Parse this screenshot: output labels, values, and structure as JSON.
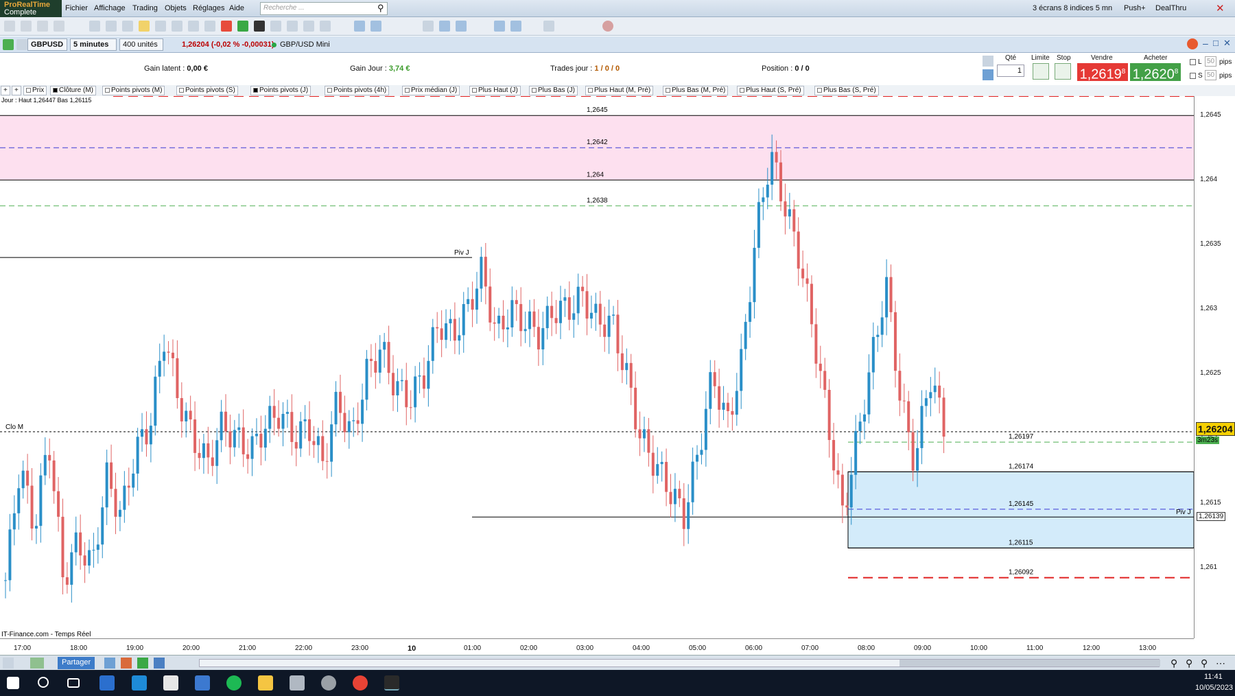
{
  "app": {
    "logo_line1": "ProRealTime",
    "logo_line2": "Complete"
  },
  "menu": [
    "Fichier",
    "Affichage",
    "Trading",
    "Objets",
    "Réglages",
    "Aide"
  ],
  "search": {
    "placeholder": "Recherche ..."
  },
  "topright": {
    "screens": "3 écrans 8 indices 5 mn",
    "push": "Push+",
    "dealthru": "DealThru"
  },
  "controls": {
    "instrument": "GBPUSD",
    "timeframe": "5 minutes",
    "units": "400 unités",
    "price_change": "1,26204 (-0,02 % -0,00031)",
    "market_name": "GBP/USD Mini"
  },
  "info": {
    "latent_label": "Gain latent :",
    "latent_value": "0,00 €",
    "day_gain_label": "Gain Jour :",
    "day_gain_value": "3,74 €",
    "trades_label": "Trades jour :",
    "trades_value": "1 / 0 / 0",
    "position_label": "Position :",
    "position_value": "0",
    "position_value2": "/ 0"
  },
  "order": {
    "qty_label": "Qté",
    "qty_value": "1",
    "limit_label": "Limite",
    "stop_label": "Stop",
    "sell_label": "Vendre",
    "sell_price": "1,2619",
    "sell_sup": "8",
    "buy_label": "Acheter",
    "buy_price": "1,2620",
    "buy_sup": "8",
    "l_label": "L",
    "s_label": "S",
    "pips_value": "50",
    "pips_label": "pips"
  },
  "tabs": [
    "Prix",
    "Clôture (M)",
    "Points pivots (M)",
    "Points pivots (S)",
    "Points pivots (J)",
    "Points pivots (4h)",
    "Prix médian (J)",
    "Plus Haut (J)",
    "Plus Bas (J)",
    "Plus Haut (M, Pré)",
    "Plus Bas (M, Pré)",
    "Plus Haut (S, Pré)",
    "Plus Bas (S, Pré)"
  ],
  "chart_legend": "Jour : Haut 1,26447 Bas 1,26115",
  "chart_data": {
    "type": "candlestick",
    "ylim": [
      1.26045,
      1.26465
    ],
    "price_ticks": [
      "1,2645",
      "1,264",
      "1,2635",
      "1,263",
      "1,2625",
      "1,262",
      "1,2615",
      "1,261"
    ],
    "price_tick_values": [
      1.2645,
      1.264,
      1.2635,
      1.263,
      1.2625,
      1.262,
      1.2615,
      1.261
    ],
    "time_ticks": [
      "17:00",
      "18:00",
      "19:00",
      "20:00",
      "21:00",
      "22:00",
      "23:00",
      "10",
      "01:00",
      "02:00",
      "03:00",
      "04:00",
      "05:00",
      "06:00",
      "07:00",
      "08:00",
      "09:00",
      "10:00",
      "11:00",
      "12:00",
      "13:00"
    ],
    "levels": [
      {
        "label": "1,2645",
        "value": 1.2645,
        "color": "#000000",
        "style": "solid"
      },
      {
        "label": "1,2642",
        "value": 1.26425,
        "color": "#3b3bd6",
        "style": "dashed"
      },
      {
        "label": "1,264",
        "value": 1.264,
        "color": "#000000",
        "style": "solid"
      },
      {
        "label": "1,2638",
        "value": 1.2638,
        "color": "#4caf50",
        "style": "dashed"
      },
      {
        "label": "1,26197",
        "value": 1.26197,
        "color": "#4caf50",
        "style": "dashed"
      },
      {
        "label": "1,26174",
        "value": 1.26174,
        "color": "#000000",
        "style": "solid"
      },
      {
        "label": "1,26145",
        "value": 1.26145,
        "color": "#3b3bd6",
        "style": "dashed"
      },
      {
        "label": "1,26115",
        "value": 1.26115,
        "color": "#000000",
        "style": "solid"
      },
      {
        "label": "1,26092",
        "value": 1.26092,
        "color": "#e02020",
        "style": "dashed"
      }
    ],
    "pivot_label": "Piv J",
    "pivot_right_label": "Piv J",
    "pivot_value": 1.26139,
    "clo_label": "Clo M",
    "clo_value": 1.26205,
    "zone_pink": [
      1.264,
      1.2645
    ],
    "zone_blue": [
      1.26115,
      1.26174
    ],
    "current_price": "1,26204",
    "countdown": "3m23s",
    "pivot_price_label": "1,26139",
    "red_top_value": 1.26465
  },
  "source": "IT-Finance.com - Temps Réel",
  "bottom": {
    "share": "Partager"
  },
  "clock": {
    "time": "11:41",
    "date": "10/05/2023"
  },
  "colors": {
    "up": "#2a8fc8",
    "down": "#e06464"
  }
}
